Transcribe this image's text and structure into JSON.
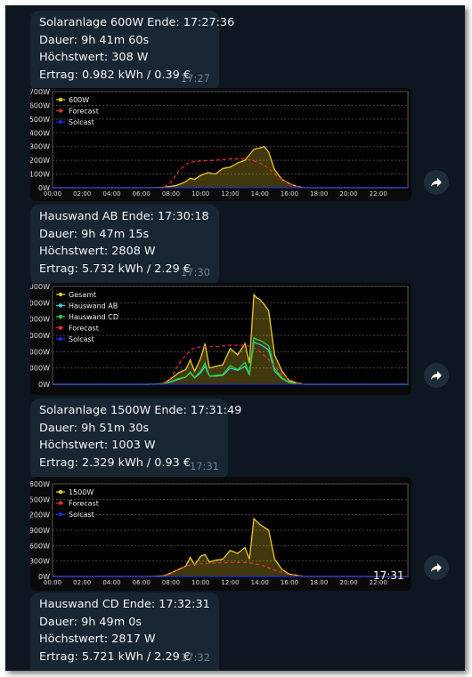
{
  "messages": [
    {
      "lines": [
        "Solaranlage 600W Ende: 17:27:36",
        "Dauer: 9h 41m 60s",
        "Höchstwert: 308 W",
        "Ertrag: 0.982 kWh / 0.39 €"
      ],
      "time": "17:27"
    },
    {
      "lines": [
        "Hauswand AB Ende: 17:30:18",
        "Dauer: 9h 47m 15s",
        "Höchstwert: 2808 W",
        "Ertrag: 5.732 kWh / 2.29 €"
      ],
      "time": "17:30"
    },
    {
      "lines": [
        "Solaranlage 1500W Ende: 17:31:49",
        "Dauer: 9h 51m 30s",
        "Höchstwert: 1003 W",
        "Ertrag: 2.329 kWh / 0.93 €"
      ],
      "time": "17:31"
    },
    {
      "lines": [
        "Hauswand CD Ende: 17:32:31",
        "Dauer: 9h 49m 0s",
        "Höchstwert: 2817 W",
        "Ertrag: 5.721 kWh / 2.29 €"
      ],
      "time": "17:32"
    }
  ],
  "chart_overlay_time": "17:31",
  "icons": {
    "forward": "forward-arrow-icon"
  },
  "colors": {
    "background": "#0e1621",
    "bubble": "#182533",
    "time": "#6d7f8f"
  },
  "chart_data": [
    {
      "type": "line",
      "x_ticks": [
        "00:00",
        "02:00",
        "04:00",
        "06:00",
        "08:00",
        "10:00",
        "12:00",
        "14:00",
        "16:00",
        "18:00",
        "20:00",
        "22:00"
      ],
      "y_ticks": [
        "0W",
        "100W",
        "200W",
        "300W",
        "400W",
        "500W",
        "600W",
        "700W"
      ],
      "ylim": [
        0,
        700
      ],
      "xlim": [
        0,
        24
      ],
      "legend_position": "top-left",
      "grid": true,
      "series": [
        {
          "name": "600W",
          "color": "#e8c830",
          "fill": true,
          "x": [
            0,
            6.5,
            7.5,
            8.3,
            8.7,
            9,
            9.3,
            9.6,
            10,
            10.5,
            11,
            11.5,
            12,
            12.5,
            13,
            13.3,
            13.6,
            14,
            14.3,
            14.6,
            15,
            15.5,
            16,
            16.5,
            17,
            18,
            24
          ],
          "y": [
            0,
            0,
            3,
            15,
            30,
            45,
            70,
            60,
            90,
            110,
            100,
            140,
            150,
            180,
            200,
            240,
            280,
            290,
            300,
            260,
            130,
            60,
            30,
            10,
            0,
            0,
            0
          ]
        },
        {
          "name": "Forecast",
          "color": "#e03030",
          "dashed": true,
          "x": [
            0,
            7.5,
            8,
            8.5,
            9,
            9.5,
            10,
            11,
            12,
            13,
            13.5,
            14,
            14.5,
            15,
            15.5,
            16,
            16.5,
            17,
            24
          ],
          "y": [
            0,
            0,
            40,
            120,
            170,
            190,
            195,
            200,
            210,
            210,
            200,
            180,
            150,
            100,
            60,
            30,
            10,
            0,
            0
          ]
        },
        {
          "name": "Solcast",
          "color": "#1a2bd6",
          "x": [
            0,
            24
          ],
          "y": [
            0,
            0
          ]
        }
      ]
    },
    {
      "type": "line",
      "x_ticks": [],
      "y_ticks": [
        "0W",
        "1000W",
        "2000W",
        "3000W",
        "4000W",
        "5000W",
        "6000W"
      ],
      "ylim": [
        0,
        6000
      ],
      "xlim": [
        0,
        24
      ],
      "legend_position": "top-left",
      "grid": true,
      "series": [
        {
          "name": "Gesamt",
          "color": "#e8c830",
          "fill": true,
          "x": [
            0,
            6.5,
            7.5,
            8,
            8.5,
            9,
            9.3,
            9.6,
            10,
            10.3,
            10.6,
            11,
            11.5,
            12,
            12.5,
            13,
            13.3,
            13.6,
            13.8,
            14,
            14.3,
            14.6,
            15,
            15.5,
            16,
            17,
            24
          ],
          "y": [
            0,
            0,
            50,
            350,
            700,
            900,
            1500,
            800,
            1600,
            2500,
            1000,
            1100,
            1200,
            2200,
            1800,
            2500,
            1300,
            5500,
            5300,
            5200,
            4900,
            4500,
            1800,
            800,
            200,
            0,
            0
          ]
        },
        {
          "name": "Hauswand AB",
          "color": "#30d0d0",
          "x": [
            0,
            6.5,
            7.5,
            8,
            8.5,
            9,
            9.3,
            9.6,
            10,
            10.3,
            10.6,
            11,
            11.5,
            12,
            12.5,
            13,
            13.3,
            13.6,
            13.8,
            14,
            14.3,
            14.6,
            15,
            15.5,
            16,
            17,
            24
          ],
          "y": [
            0,
            0,
            20,
            150,
            300,
            450,
            700,
            400,
            700,
            1100,
            500,
            500,
            550,
            1000,
            850,
            1100,
            600,
            2600,
            2500,
            2450,
            2300,
            2100,
            800,
            350,
            100,
            0,
            0
          ]
        },
        {
          "name": "Hauswand CD",
          "color": "#30d030",
          "x": [
            0,
            6.5,
            7.5,
            8,
            8.5,
            9,
            9.3,
            9.6,
            10,
            10.3,
            10.6,
            11,
            11.5,
            12,
            12.5,
            13,
            13.3,
            13.6,
            13.8,
            14,
            14.3,
            14.6,
            15,
            15.5,
            16,
            17,
            24
          ],
          "y": [
            0,
            0,
            25,
            180,
            350,
            450,
            750,
            420,
            800,
            1300,
            500,
            550,
            600,
            1150,
            900,
            1350,
            650,
            2850,
            2750,
            2700,
            2550,
            2350,
            950,
            400,
            100,
            0,
            0
          ]
        },
        {
          "name": "Forecast",
          "color": "#e03030",
          "dashed": true,
          "x": [
            0,
            7.5,
            8,
            8.5,
            9,
            9.5,
            10,
            11,
            12,
            13,
            13.5,
            14,
            14.5,
            15,
            15.5,
            16,
            16.5,
            17,
            24
          ],
          "y": [
            0,
            0,
            400,
            1200,
            1800,
            2200,
            2300,
            2300,
            2400,
            2400,
            2300,
            2000,
            1600,
            1100,
            600,
            300,
            100,
            0,
            0
          ]
        },
        {
          "name": "Solcast",
          "color": "#1a2bd6",
          "x": [
            0,
            24
          ],
          "y": [
            0,
            0
          ]
        }
      ]
    },
    {
      "type": "line",
      "x_ticks": [
        "00:00",
        "02:00",
        "04:00",
        "06:00",
        "08:00",
        "10:00",
        "12:00",
        "14:00",
        "16:00",
        "18:00",
        "20:00",
        "22:00"
      ],
      "y_ticks": [
        "0W",
        "300W",
        "600W",
        "900W",
        "1200W",
        "1500W",
        "1600W"
      ],
      "ylim": [
        0,
        1600
      ],
      "xlim": [
        0,
        24
      ],
      "legend_position": "top-left",
      "grid": true,
      "series": [
        {
          "name": "1500W",
          "color": "#e8c830",
          "fill": true,
          "x": [
            0,
            6.5,
            7.5,
            8,
            8.5,
            9,
            9.3,
            9.6,
            10,
            10.3,
            10.6,
            11,
            11.5,
            12,
            12.5,
            13,
            13.3,
            13.6,
            13.8,
            14,
            14.3,
            14.6,
            15,
            15.5,
            16,
            17,
            24
          ],
          "y": [
            0,
            0,
            10,
            60,
            120,
            180,
            330,
            200,
            350,
            380,
            250,
            280,
            300,
            450,
            400,
            500,
            300,
            1000,
            950,
            900,
            850,
            800,
            300,
            120,
            40,
            0,
            0
          ]
        },
        {
          "name": "Forecast",
          "color": "#e03030",
          "dashed": true,
          "x": [
            0,
            7.5,
            8,
            8.5,
            9,
            9.5,
            10,
            11,
            12,
            13,
            13.5,
            14,
            14.5,
            15,
            15.5,
            16,
            16.5,
            17,
            24
          ],
          "y": [
            0,
            0,
            50,
            130,
            180,
            210,
            220,
            230,
            240,
            240,
            230,
            200,
            160,
            110,
            70,
            30,
            10,
            0,
            0
          ]
        },
        {
          "name": "Solcast",
          "color": "#1a2bd6",
          "x": [
            0,
            24
          ],
          "y": [
            0,
            0
          ]
        }
      ]
    }
  ]
}
